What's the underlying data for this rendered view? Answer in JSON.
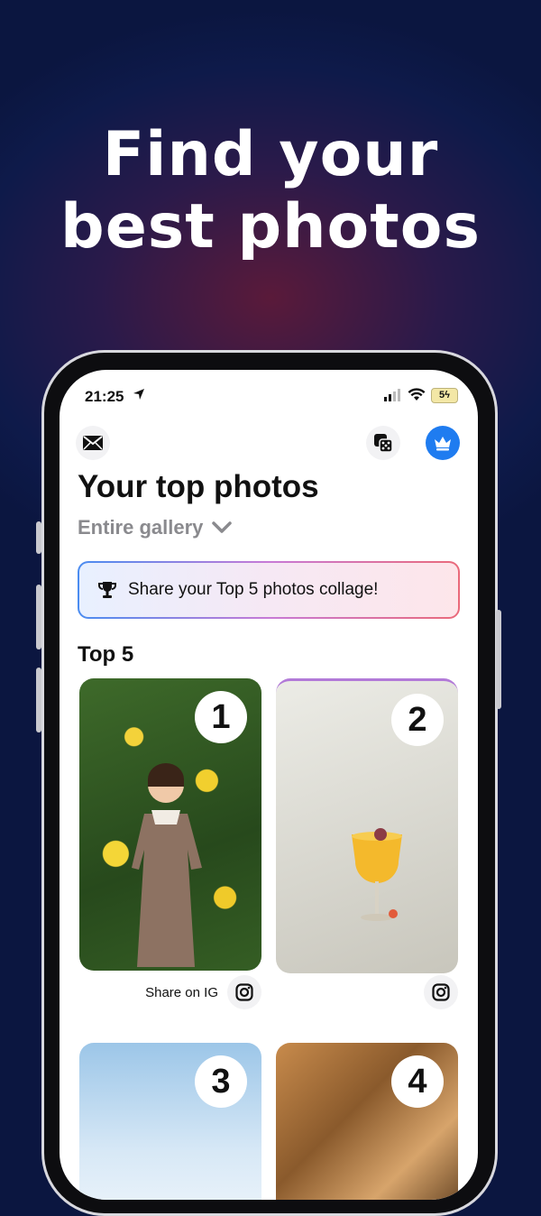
{
  "promo": {
    "headline_line1": "Find your",
    "headline_line2": "best photos"
  },
  "status_bar": {
    "time": "21:25",
    "battery": "5"
  },
  "toolbar": {
    "icons": [
      "mail-icon",
      "dice-icon",
      "crown-icon"
    ],
    "accent": "#1f7cf0"
  },
  "main": {
    "title": "Your top photos",
    "scope": "Entire gallery",
    "banner": "Share your Top 5 photos collage!",
    "section_title": "Top 5",
    "photos": [
      {
        "rank": "1",
        "share_label": "Share on IG"
      },
      {
        "rank": "2"
      },
      {
        "rank": "3"
      },
      {
        "rank": "4"
      }
    ]
  }
}
